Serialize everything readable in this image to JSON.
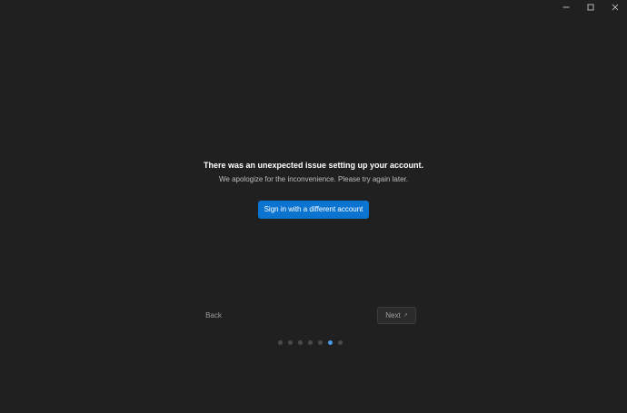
{
  "window": {
    "controls": [
      {
        "name": "minimize-icon",
        "glyph": "minimize"
      },
      {
        "name": "maximize-icon",
        "glyph": "maximize"
      },
      {
        "name": "close-icon",
        "glyph": "close"
      }
    ]
  },
  "message": {
    "title": "There was an unexpected issue setting up your account.",
    "subtitle": "We apologize for the inconvenience. Please try again later.",
    "primary_button": "Sign in with a different account"
  },
  "navigation": {
    "back_label": "Back",
    "next_label": "Next",
    "next_icon": "↗"
  },
  "progress": {
    "total_steps": 7,
    "current_step": 6
  },
  "colors": {
    "background": "#202020",
    "accent": "#0a74d0",
    "active_dot": "#4c9be8"
  }
}
